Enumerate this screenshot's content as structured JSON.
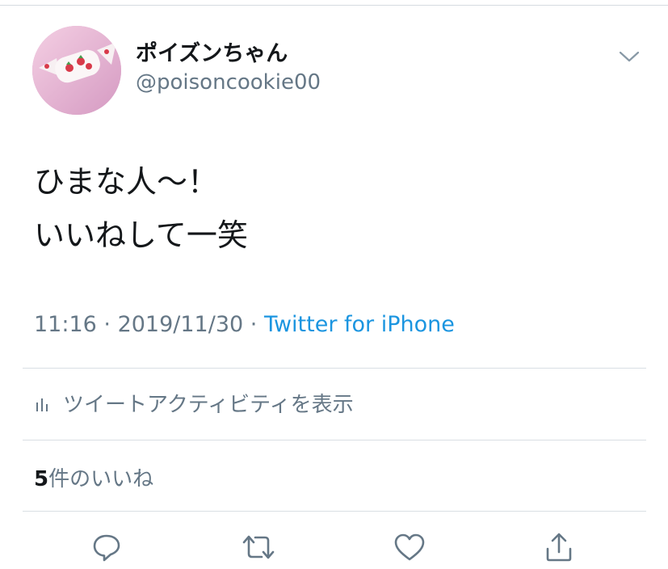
{
  "author": {
    "display_name": "ポイズンちゃん",
    "handle": "@poisoncookie00"
  },
  "tweet": {
    "line1": "ひまな人〜！",
    "line2": "いいねして一笑",
    "time": "11:16",
    "separator": " · ",
    "date": "2019/11/30",
    "source": "Twitter for iPhone"
  },
  "activity": {
    "label": "ツイートアクティビティを表示"
  },
  "likes": {
    "count": "5",
    "label": "件のいいね"
  },
  "actions": [
    "reply-icon",
    "retweet-icon",
    "like-icon",
    "share-icon"
  ],
  "colors": {
    "text": "#14171a",
    "secondary": "#657786",
    "link": "#1b95e0",
    "divider": "#d9dfe4"
  }
}
